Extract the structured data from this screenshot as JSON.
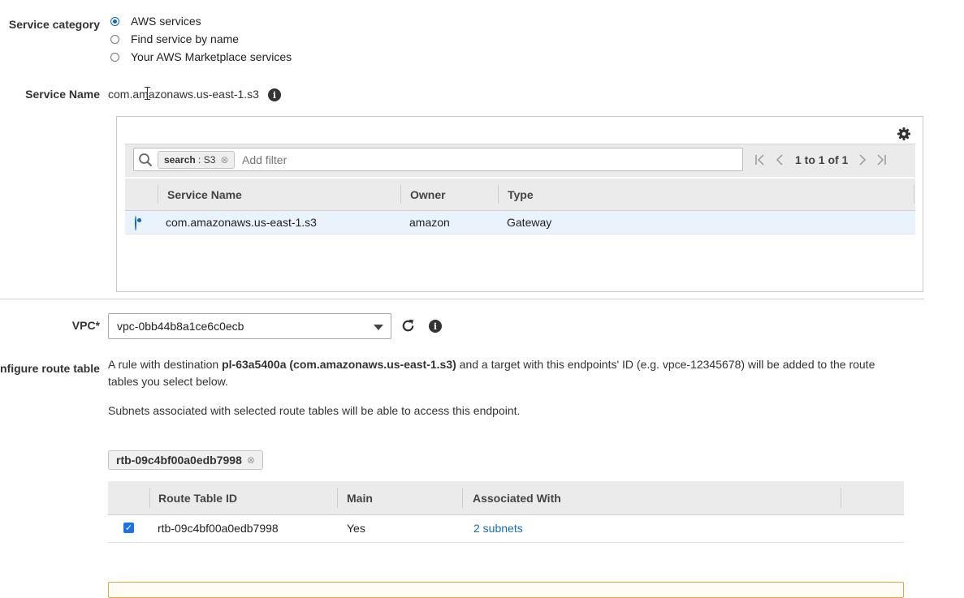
{
  "service_category": {
    "label": "Service category",
    "options": [
      {
        "label": "AWS services",
        "selected": true
      },
      {
        "label": "Find service by name",
        "selected": false
      },
      {
        "label": "Your AWS Marketplace services",
        "selected": false
      }
    ]
  },
  "service_name": {
    "label": "Service Name",
    "value": "com.amazonaws.us-east-1.s3"
  },
  "services_table": {
    "filter_token_key": "search",
    "filter_token_value": "S3",
    "filter_placeholder": "Add filter",
    "pagination": "1 to 1 of 1",
    "columns": [
      "Service Name",
      "Owner",
      "Type"
    ],
    "rows": [
      {
        "service_name": "com.amazonaws.us-east-1.s3",
        "owner": "amazon",
        "type": "Gateway",
        "selected": true
      }
    ]
  },
  "vpc": {
    "label": "VPC*",
    "value": "vpc-0bb44b8a1ce6c0ecb"
  },
  "route_tables": {
    "label": "nfigure route tables",
    "desc_prefix": "A rule with destination ",
    "desc_bold": "pl-63a5400a (com.amazonaws.us-east-1.s3)",
    "desc_suffix_line1": " and a target with this endpoints' ID (e.g. vpce-12345678) will be added to the route",
    "desc_line2": "tables you select below.",
    "subnets_note": "Subnets associated with selected route tables will be able to access this endpoint.",
    "token": "rtb-09c4bf00a0edb7998",
    "columns": [
      "Route Table ID",
      "Main",
      "Associated With"
    ],
    "rows": [
      {
        "route_table_id": "rtb-09c4bf00a0edb7998",
        "main": "Yes",
        "associated_with": "2 subnets",
        "checked": true
      }
    ]
  },
  "icons": [
    "info-icon",
    "gear-icon",
    "search-icon",
    "first-page-icon",
    "prev-page-icon",
    "next-page-icon",
    "last-page-icon",
    "refresh-icon",
    "chevron-down-icon",
    "close-icon",
    "checkbox-icon"
  ],
  "colors": {
    "accent": "#1166bb",
    "link": "#1a6db5",
    "selected_row": "#eaf3fc",
    "warning_border": "#e8a34a"
  }
}
